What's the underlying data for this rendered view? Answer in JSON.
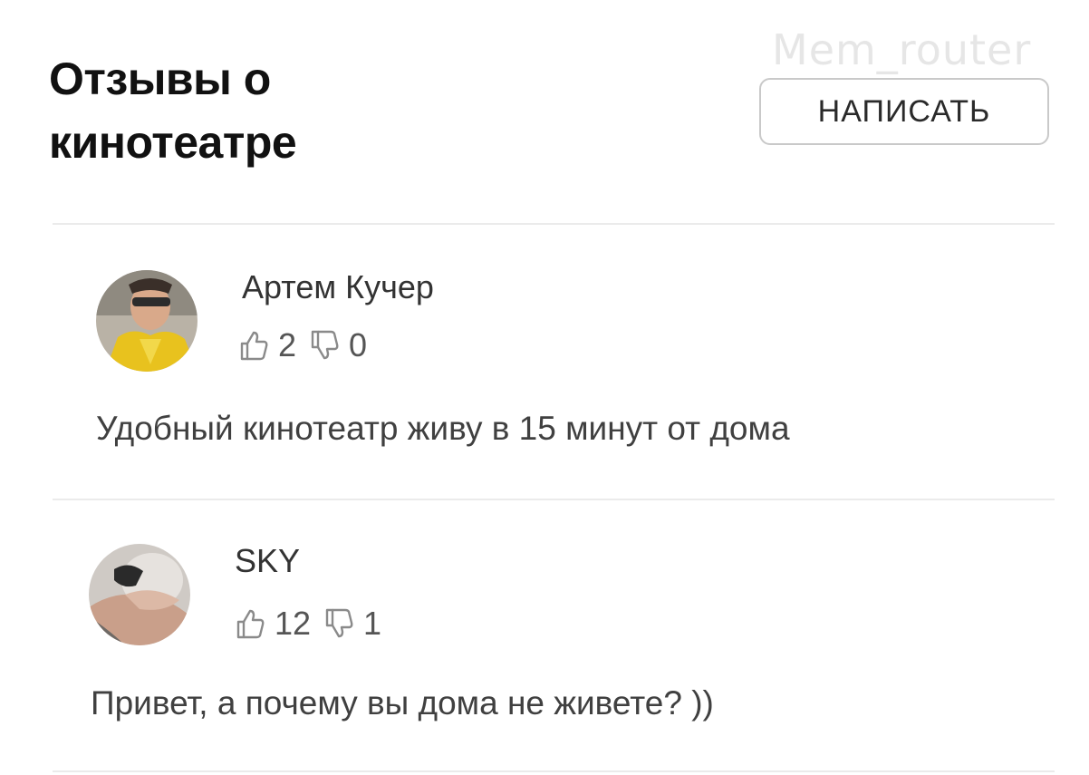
{
  "watermark": "Mem_router",
  "header": {
    "title": "Отзывы о кинотеатре",
    "write_button": "НАПИСАТЬ"
  },
  "reviews": [
    {
      "author": "Артем Кучер",
      "likes": "2",
      "dislikes": "0",
      "text": "Удобный кинотеатр живу в 15 минут от дома"
    },
    {
      "author": "SKY",
      "likes": "12",
      "dislikes": "1",
      "text": "Привет, а почему вы дома не живете? ))"
    }
  ],
  "icons": {
    "like": "thumbs-up-icon",
    "dislike": "thumbs-down-icon"
  }
}
